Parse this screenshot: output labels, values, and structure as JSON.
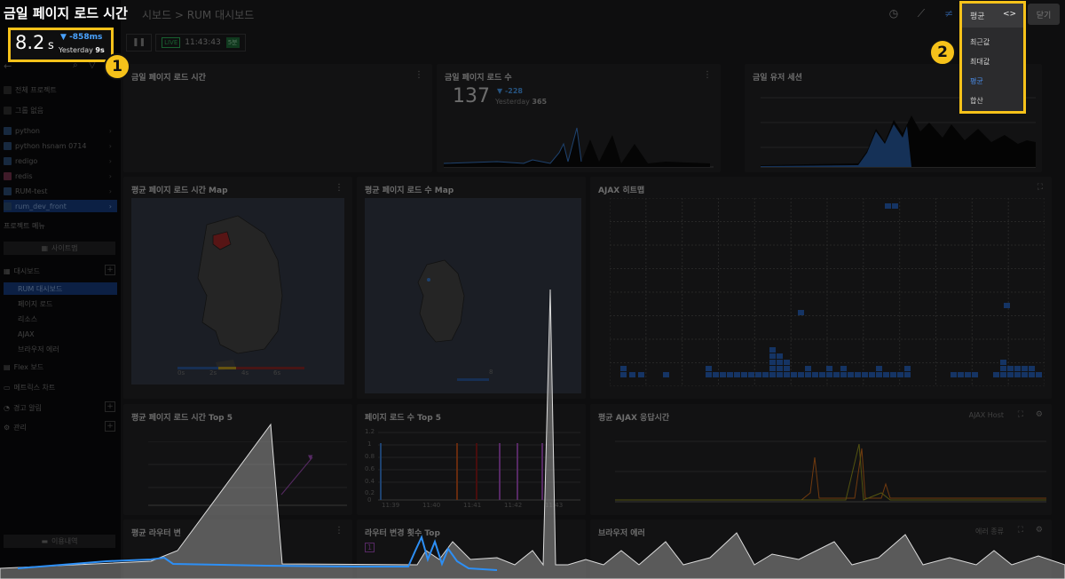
{
  "page": {
    "title": "금일 페이지 로드 시간"
  },
  "breadcrumb": "시보드 > RUM 대시보드",
  "metric": {
    "value": "8.2",
    "unit": "s",
    "delta": "-858ms",
    "yesterday_label": "Yesterday",
    "yesterday_value": "9s"
  },
  "markers": [
    "1",
    "2"
  ],
  "controls": {
    "live": "LIVE",
    "time": "11:43:43",
    "range": "5분"
  },
  "header": {
    "close_label": "닫기"
  },
  "dropdown": {
    "selected_label": "평균",
    "code_icon": "<>",
    "options": [
      {
        "label": "최근값",
        "selected": false
      },
      {
        "label": "최대값",
        "selected": false
      },
      {
        "label": "평균",
        "selected": true
      },
      {
        "label": "합산",
        "selected": false
      }
    ]
  },
  "sidebar": {
    "projects": [
      {
        "label": "전체 프로젝트",
        "active": false
      },
      {
        "label": "그룹 없음",
        "active": false
      },
      {
        "label": "python",
        "active": false
      },
      {
        "label": "python hsnam 0714",
        "active": false
      },
      {
        "label": "redigo",
        "active": false
      },
      {
        "label": "redis",
        "active": false
      },
      {
        "label": "RUM-test",
        "active": false
      },
      {
        "label": "rum_dev_front",
        "active": true
      }
    ],
    "section_title": "프로젝트 메뉴",
    "sitemap_label": "사이트맵",
    "menu": [
      {
        "label": "대시보드",
        "active": false
      },
      {
        "label": "RUM 대시보드",
        "active": true
      },
      {
        "label": "페이지 로드",
        "active": false
      },
      {
        "label": "리소스",
        "active": false
      },
      {
        "label": "AJAX",
        "active": false
      },
      {
        "label": "브라우저 에러",
        "active": false
      },
      {
        "label": "Flex 보드",
        "active": false
      },
      {
        "label": "메트릭스 차트",
        "active": false
      },
      {
        "label": "경고 알림",
        "active": false
      },
      {
        "label": "관리",
        "active": false
      }
    ],
    "usage_label": "이용내역"
  },
  "cards": {
    "load_time": {
      "title": "금일 페이지 로드 시간"
    },
    "load_count": {
      "title": "금일 페이지 로드 수",
      "value": "137",
      "delta": "-228",
      "yesterday_label": "Yesterday",
      "yesterday_value": "365"
    },
    "sessions": {
      "title": "금일 유저 세션"
    },
    "map_time": {
      "title": "평균 페이지 로드 시간 Map",
      "legend": [
        "0s",
        "2s",
        "4s",
        "6s"
      ]
    },
    "map_count": {
      "title": "평균 페이지 로드 수 Map",
      "legend_max": "8"
    },
    "ajax_heat": {
      "title": "AJAX 히트맵"
    },
    "top5_time": {
      "title": "평균 페이지 로드 시간 Top 5"
    },
    "top5_count": {
      "title": "페이지 로드 수 Top 5",
      "y_ticks": [
        "1.2",
        "1",
        "0.8",
        "0.6",
        "0.4",
        "0.2",
        "0"
      ],
      "x_ticks": [
        "11:39",
        "11:40",
        "11:41",
        "11:42",
        "11:43"
      ]
    },
    "ajax_resp": {
      "title": "평균 AJAX 응답시간",
      "selector": "AJAX Host"
    },
    "router_time": {
      "title": "평균 라우터 변"
    },
    "router_count": {
      "title": "라우터 변경 횟수 Top",
      "badge": "1"
    },
    "browser_error": {
      "title": "브라우저 에러",
      "selector": "에러 종류"
    }
  }
}
